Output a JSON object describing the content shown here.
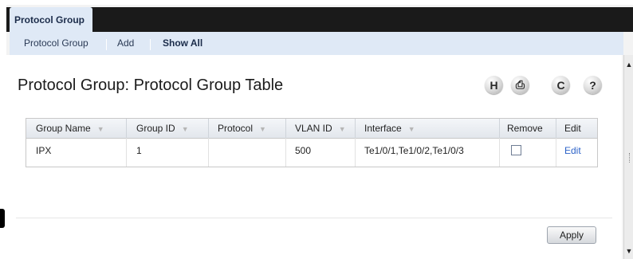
{
  "tabs": {
    "active": "Protocol Group"
  },
  "subnav": {
    "items": [
      "Protocol Group",
      "Add",
      "Show All"
    ]
  },
  "page": {
    "title": "Protocol Group: Protocol Group Table"
  },
  "toolbar": {
    "save_glyph": "H",
    "print_glyph": "⎙",
    "refresh_glyph": "C",
    "help_glyph": "?"
  },
  "table": {
    "headers": [
      "Group Name",
      "Group ID",
      "Protocol",
      "VLAN ID",
      "Interface",
      "Remove",
      "Edit"
    ],
    "sort_glyph": "▼",
    "rows": [
      {
        "group_name": "IPX",
        "group_id": "1",
        "protocol": "",
        "vlan_id": "500",
        "interface": "Te1/0/1,Te1/0/2,Te1/0/3",
        "remove_checked": false,
        "edit": "Edit"
      }
    ]
  },
  "actions": {
    "apply_label": "Apply"
  },
  "scroll": {
    "up_glyph": "▲",
    "down_glyph": "▼"
  },
  "colors": {
    "header_bar": "#1a1a1a",
    "tab_bg": "#dfe9f6",
    "link": "#2d63c8"
  }
}
